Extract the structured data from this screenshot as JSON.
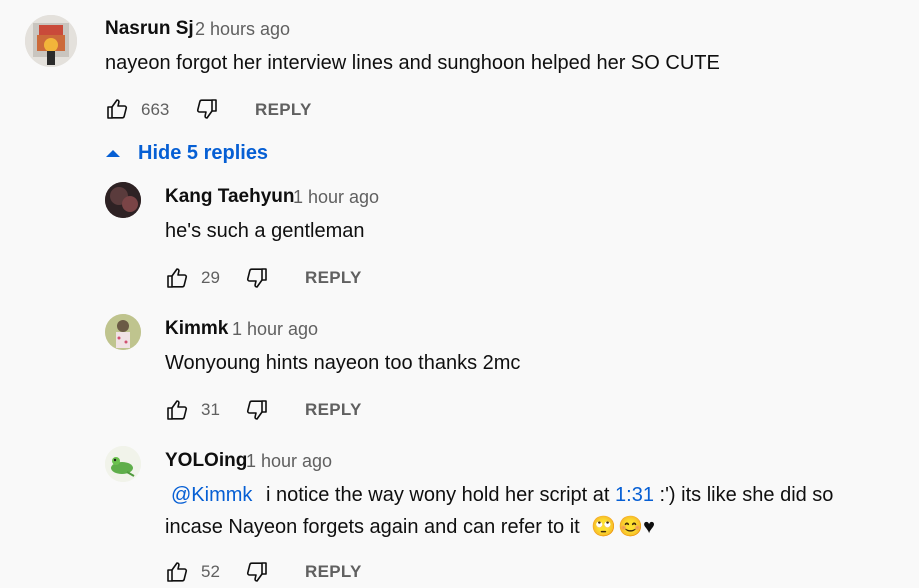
{
  "comment": {
    "author": "Nasrun Sj",
    "time": "2 hours ago",
    "text": "nayeon forgot her interview lines and sunghoon helped her SO CUTE",
    "likes": "663",
    "reply_label": "REPLY"
  },
  "hide_replies_label": "Hide 5 replies",
  "replies": [
    {
      "author": "Kang Taehyun",
      "time": "1 hour ago",
      "text": "he's such a gentleman",
      "likes": "29",
      "reply_label": "REPLY"
    },
    {
      "author": "Kimmk",
      "time": "1 hour ago",
      "text": "Wonyoung hints nayeon too thanks 2mc",
      "likes": "31",
      "reply_label": "REPLY"
    },
    {
      "author": "YOLOing",
      "time": "1 hour ago",
      "mention": "@Kimmk",
      "text_part1": "i notice the way wony hold her script at",
      "timestamp_link": "1:31",
      "text_part2": ":') its like she did so",
      "text_line2": "incase Nayeon forgets again and can refer to it",
      "emoji_1": "🙄",
      "emoji_2": "😊",
      "heart": "♥",
      "likes": "52",
      "reply_label": "REPLY"
    }
  ],
  "colors": {
    "link": "#065fd4",
    "meta": "#606060",
    "background": "#f9f9f9"
  }
}
